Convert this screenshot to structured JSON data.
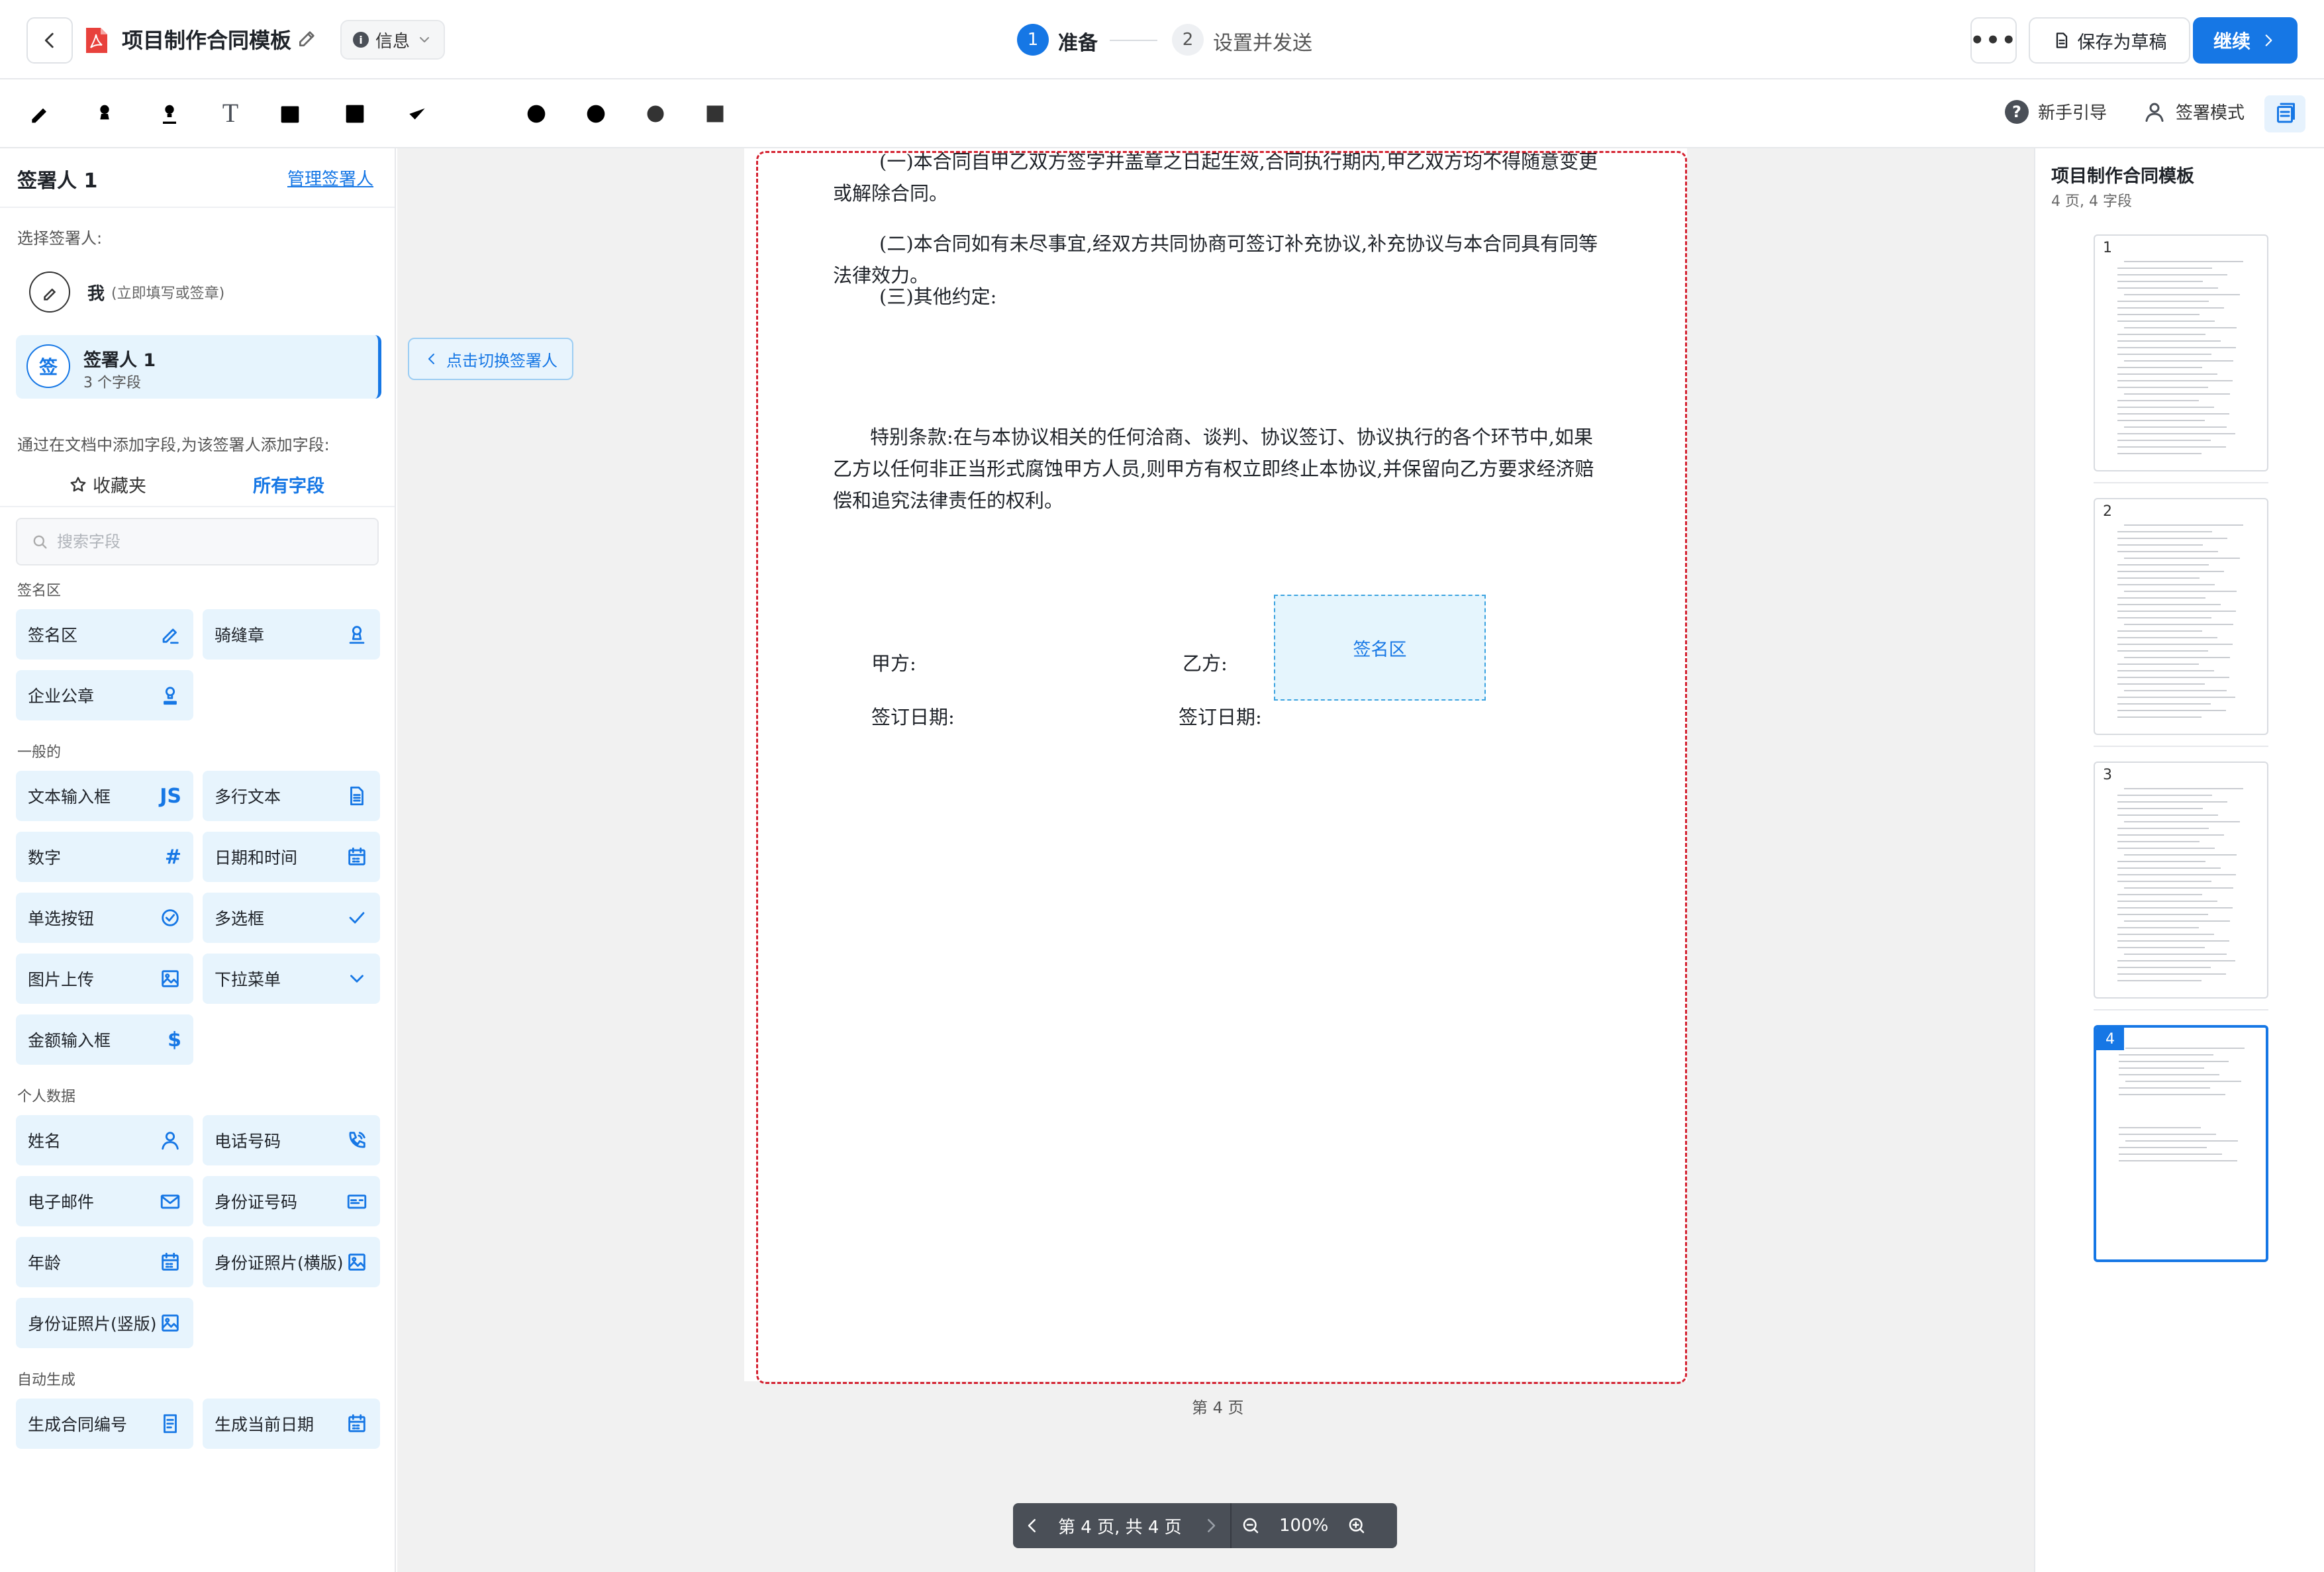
{
  "header": {
    "title": "项目制作合同模板",
    "info_label": "信息",
    "step1_num": "1",
    "step1_label": "准备",
    "step2_num": "2",
    "step2_label": "设置并发送",
    "more_label": "•••",
    "save_draft_label": "保存为草稿",
    "continue_label": "继续"
  },
  "toolbar": {
    "text_tool_glyph": "T",
    "guide_q": "?",
    "guide_label": "新手引导",
    "signer_mode_label": "签署模式"
  },
  "sidebar": {
    "signer_title": "签署人 1",
    "manage_link": "管理签署人",
    "choose_label": "选择签署人:",
    "me_name": "我",
    "me_note": "(立即填写或签章)",
    "signer_avatar": "签",
    "signer_name": "签署人 1",
    "signer_fields": "3 个字段",
    "add_hint": "通过在文档中添加字段,为该签署人添加字段:",
    "tab_favorites": "收藏夹",
    "tab_all": "所有字段",
    "search_placeholder": "搜索字段",
    "groups": {
      "signature": "签名区",
      "general": "一般的",
      "personal": "个人数据",
      "auto": "自动生成"
    },
    "fields": {
      "signature_area": "签名区",
      "seal_across": "骑缝章",
      "company_seal": "企业公章",
      "text_input": "文本输入框",
      "text_input_glyph": "JS",
      "multiline_text": "多行文本",
      "number": "数字",
      "number_glyph": "#",
      "date_time": "日期和时间",
      "radio": "单选按钮",
      "checkbox": "多选框",
      "image_upload": "图片上传",
      "dropdown": "下拉菜单",
      "amount": "金额输入框",
      "amount_glyph": "$",
      "name": "姓名",
      "phone": "电话号码",
      "email": "电子邮件",
      "id_number": "身份证号码",
      "age": "年龄",
      "id_photo_landscape": "身份证照片(横版)",
      "id_photo_portrait": "身份证照片(竖版)",
      "contract_no": "生成合同编号",
      "current_date": "生成当前日期"
    }
  },
  "document": {
    "para1": "(一)本合同自甲乙双方签字并盖章之日起生效,合同执行期内,甲乙双方均不得随意变更或解除合同。",
    "para2": "(二)本合同如有未尽事宜,经双方共同协商可签订补充协议,补充协议与本合同具有同等法律效力。",
    "para3": "(三)其他约定:",
    "para4": "特别条款:在与本协议相关的任何洽商、谈判、协议签订、协议执行的各个环节中,如果乙方以任何非正当形式腐蚀甲方人员,则甲方有权立即终止本协议,并保留向乙方要求经济赔偿和追究法律责任的权利。",
    "party_a": "甲方:",
    "party_b": "乙方:",
    "date_a": "签订日期:",
    "date_b": "签订日期:",
    "sign_field_label": "签名区",
    "switch_hint": "点击切换签署人",
    "page_label": "第 4 页"
  },
  "pager": {
    "page_info": "第 4 页, 共 4 页",
    "zoom": "100%"
  },
  "thumbs": {
    "title": "项目制作合同模板",
    "meta": "4 页, 4 字段",
    "pages": [
      "1",
      "2",
      "3",
      "4"
    ],
    "current_page": 4
  },
  "colors": {
    "accent": "#1677e5",
    "selection_border": "#d4202f",
    "field_bg": "#e7f4fd"
  }
}
